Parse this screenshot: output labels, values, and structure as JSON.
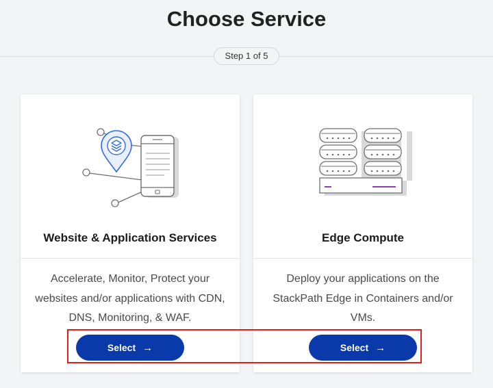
{
  "header": {
    "title": "Choose Service",
    "step": "Step 1 of 5"
  },
  "cards": [
    {
      "title": "Website & Application Services",
      "description": "Accelerate, Monitor, Protect your websites and/or applications with CDN, DNS, Monitoring, & WAF.",
      "button_label": "Select",
      "illustration": "mobile-app-location-icon"
    },
    {
      "title": "Edge Compute",
      "description": "Deploy your applications on the StackPath Edge in Containers and/or VMs.",
      "button_label": "Select",
      "illustration": "server-stack-icon"
    }
  ],
  "icons": {
    "button_arrow": "→"
  },
  "colors": {
    "primary_button": "#0a3aa9",
    "highlight": "#e0201c",
    "accent_blue": "#2f69e8",
    "accent_purple": "#8a3fb5"
  }
}
